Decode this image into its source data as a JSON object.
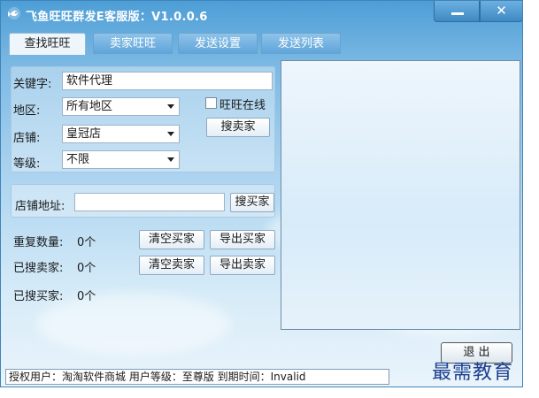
{
  "window": {
    "title": "飞鱼旺旺群发E客服版：V1.0.0.6",
    "minimize_icon": "minimize-icon",
    "close_label": "✕"
  },
  "tabs": [
    {
      "label": "查找旺旺",
      "active": true
    },
    {
      "label": "卖家旺旺",
      "active": false
    },
    {
      "label": "发送设置",
      "active": false
    },
    {
      "label": "发送列表",
      "active": false
    }
  ],
  "search": {
    "keyword_label": "关键字:",
    "keyword_value": "软件代理",
    "region_label": "地区:",
    "region_value": "所有地区",
    "shop_label": "店铺:",
    "shop_value": "皇冠店",
    "level_label": "等级:",
    "level_value": "不限",
    "online_label": "旺旺在线",
    "online_checked": false,
    "search_seller_button": "搜卖家"
  },
  "shop_url": {
    "label": "店铺地址:",
    "value": "",
    "search_buyer_button": "搜买家"
  },
  "stats": {
    "duplicate_label": "重复数量:",
    "duplicate_value": "0个",
    "searched_sellers_label": "已搜卖家:",
    "searched_sellers_value": "0个",
    "searched_buyers_label": "已搜买家:",
    "searched_buyers_value": "0个",
    "clear_buyers_button": "清空买家",
    "export_buyers_button": "导出买家",
    "clear_sellers_button": "清空卖家",
    "export_sellers_button": "导出卖家"
  },
  "footer": {
    "exit_button": "退  出",
    "status_text": "授权用户：淘淘软件商城  用户等级：至尊版 到期时间：Invalid",
    "watermark": "最需教育"
  },
  "colors": {
    "title_blue": "#4d9ed6",
    "panel_bg": "#eef6fc",
    "watermark": "#1f3f8f"
  }
}
